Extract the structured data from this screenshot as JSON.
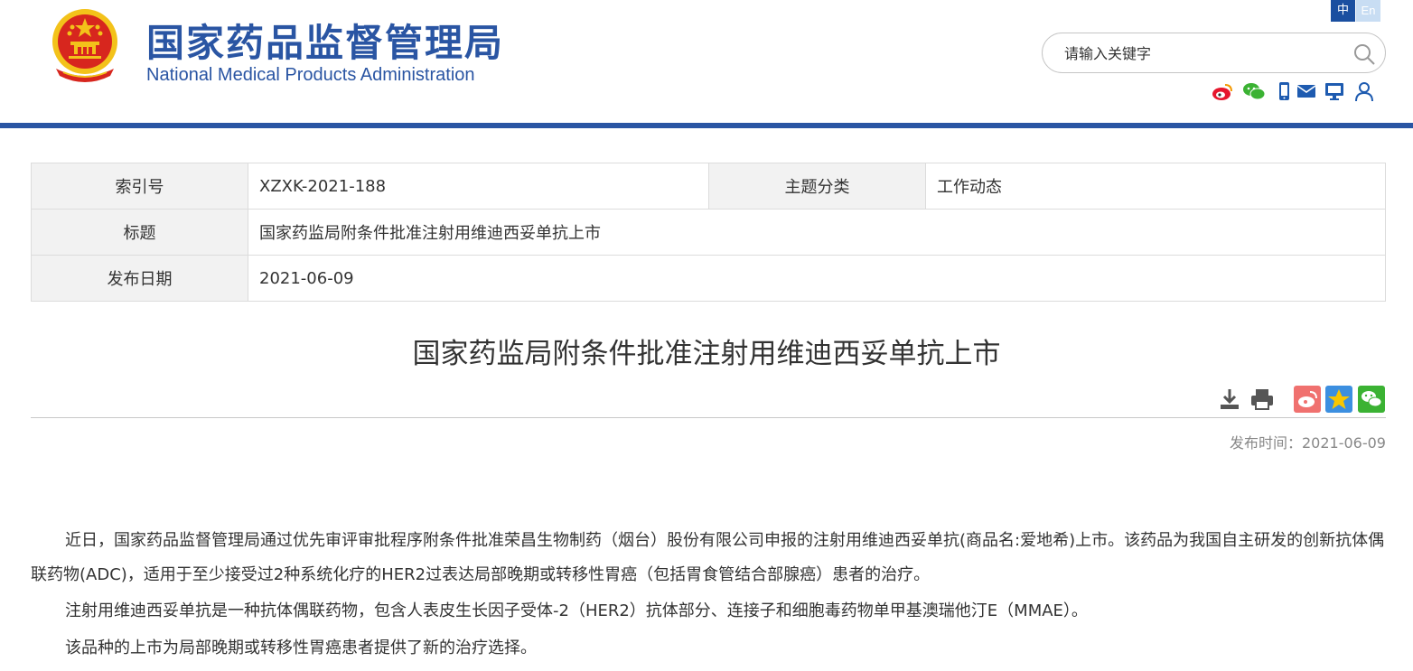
{
  "header": {
    "title_cn": "国家药品监督管理局",
    "title_en": "National Medical Products Administration",
    "lang_zh": "中",
    "lang_en": "En",
    "search_placeholder": "请输入关键字",
    "social_icons": [
      "weibo-icon",
      "wechat-icon",
      "mobile-icon",
      "mail-icon",
      "monitor-icon",
      "user-icon"
    ]
  },
  "meta": {
    "index_label": "索引号",
    "index_value": "XZXK-2021-188",
    "topic_label": "主题分类",
    "topic_value": "工作动态",
    "title_label": "标题",
    "title_value": "国家药监局附条件批准注射用维迪西妥单抗上市",
    "date_label": "发布日期",
    "date_value": "2021-06-09"
  },
  "article": {
    "title": "国家药监局附条件批准注射用维迪西妥单抗上市",
    "publish_time": "发布时间：2021-06-09",
    "paragraphs": [
      "近日，国家药品监督管理局通过优先审评审批程序附条件批准荣昌生物制药（烟台）股份有限公司申报的注射用维迪西妥单抗(商品名:爱地希)上市。该药品为我国自主研发的创新抗体偶联药物(ADC)，适用于至少接受过2种系统化疗的HER2过表达局部晚期或转移性胃癌（包括胃食管结合部腺癌）患者的治疗。",
      "注射用维迪西妥单抗是一种抗体偶联药物，包含人表皮生长因子受体-2（HER2）抗体部分、连接子和细胞毒药物单甲基澳瑞他汀E（MMAE）。",
      "该品种的上市为局部晚期或转移性胃癌患者提供了新的治疗选择。"
    ]
  },
  "colors": {
    "brand_blue": "#2a55a3",
    "emblem_red": "#d7261e",
    "emblem_gold": "#f3c21a"
  }
}
